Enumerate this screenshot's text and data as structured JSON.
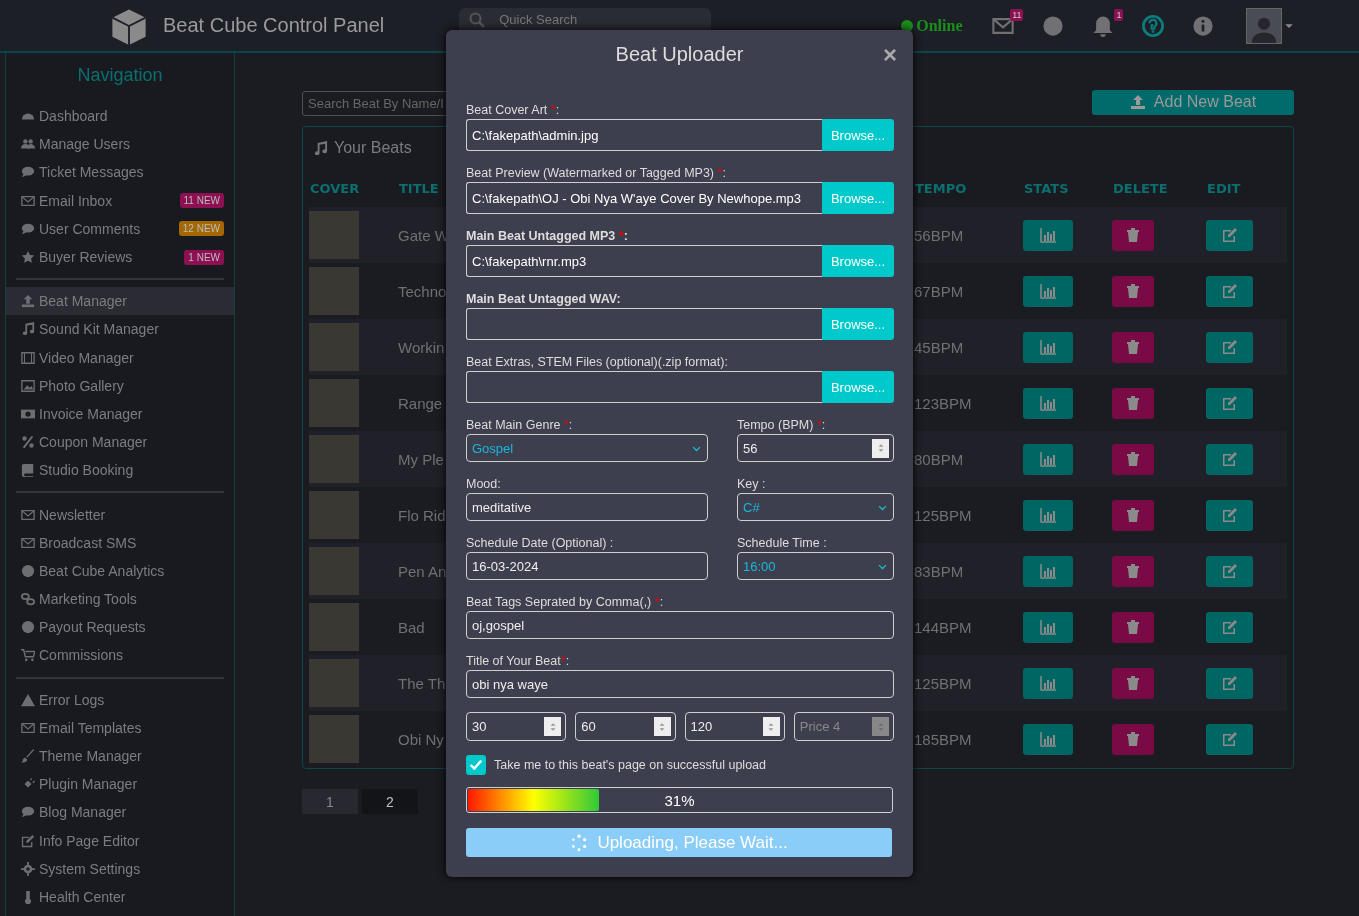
{
  "topbar": {
    "title": "Beat Cube Control Panel",
    "search": {
      "placeholder": "Quick Search"
    },
    "status": "Online",
    "mail_badge": "11",
    "bell_badge": "1"
  },
  "sidebar": {
    "title": "Navigation",
    "sections": [
      {
        "items": [
          {
            "label": "Dashboard",
            "selected": false
          },
          {
            "label": "Manage Users",
            "selected": false
          },
          {
            "label": "Ticket Messages",
            "selected": false
          },
          {
            "label": "Email Inbox",
            "selected": false,
            "badge": {
              "text": "11 NEW",
              "color": "#8c1052"
            }
          },
          {
            "label": "User Comments",
            "selected": false,
            "badge": {
              "text": "12 NEW",
              "color": "#a56800"
            }
          },
          {
            "label": "Buyer Reviews",
            "selected": false,
            "badge": {
              "text": "1 NEW",
              "color": "#8c1052"
            }
          }
        ]
      },
      {
        "items": [
          {
            "label": "Beat Manager",
            "selected": true
          },
          {
            "label": "Sound Kit Manager",
            "selected": false
          },
          {
            "label": "Video Manager",
            "selected": false
          },
          {
            "label": "Photo Gallery",
            "selected": false
          },
          {
            "label": "Invoice Manager",
            "selected": false
          },
          {
            "label": "Coupon Manager",
            "selected": false
          },
          {
            "label": "Studio Booking",
            "selected": false
          }
        ]
      },
      {
        "items": [
          {
            "label": "Newsletter",
            "selected": false
          },
          {
            "label": "Broadcast SMS",
            "selected": false
          },
          {
            "label": "Beat Cube Analytics",
            "selected": false
          },
          {
            "label": "Marketing Tools",
            "selected": false
          },
          {
            "label": "Payout Requests",
            "selected": false
          },
          {
            "label": "Commissions",
            "selected": false
          }
        ]
      },
      {
        "items": [
          {
            "label": "Error Logs",
            "selected": false
          },
          {
            "label": "Email Templates",
            "selected": false
          },
          {
            "label": "Theme Manager",
            "selected": false
          },
          {
            "label": "Plugin Manager",
            "selected": false
          },
          {
            "label": "Blog Manager",
            "selected": false
          },
          {
            "label": "Info Page Editor",
            "selected": false
          },
          {
            "label": "System Settings",
            "selected": false
          },
          {
            "label": "Health Center",
            "selected": false
          }
        ]
      }
    ]
  },
  "main": {
    "search": {
      "placeholder": "Search Beat By Name/I"
    },
    "add_button": "Add New Beat",
    "table": {
      "title": "Your Beats",
      "columns": [
        "COVER",
        "TITLE",
        "TEMPO",
        "STATS",
        "DELETE",
        "EDIT"
      ],
      "rows": [
        {
          "title": "Gate W",
          "tempo": "56BPM"
        },
        {
          "title": "Techno",
          "tempo": "67BPM"
        },
        {
          "title": "Workin",
          "tempo": "45BPM"
        },
        {
          "title": "Range",
          "tempo": "123BPM"
        },
        {
          "title": "My Ple",
          "tempo": "80BPM"
        },
        {
          "title": "Flo Rid",
          "tempo": "125BPM"
        },
        {
          "title": "Pen An",
          "tempo": "83BPM"
        },
        {
          "title": "Bad",
          "tempo": "144BPM"
        },
        {
          "title": "The Th",
          "tempo": "125BPM"
        },
        {
          "title": "Obi Ny",
          "tempo": "185BPM"
        }
      ]
    },
    "pagination": [
      {
        "label": "1",
        "selected": false
      },
      {
        "label": "2",
        "selected": true
      }
    ]
  },
  "modal": {
    "title": "Beat Uploader",
    "close": "×",
    "rows": [
      [
        {
          "kind": "file",
          "label": "Beat Cover Art ",
          "asterisk": "*",
          "tail": ":",
          "bold": false,
          "value": "C:\\fakepath\\admin.jpg",
          "button": "Browse..."
        }
      ],
      [
        {
          "kind": "file",
          "label": "Beat Preview (Watermarked or Tagged MP3) ",
          "asterisk": "*",
          "tail": ":",
          "bold": false,
          "value": "C:\\fakepath\\OJ - Obi Nya W'aye Cover By Newhope.mp3",
          "button": "Browse..."
        }
      ],
      [
        {
          "kind": "file",
          "label": "Main Beat Untagged MP3 ",
          "asterisk": "*",
          "tail": ":",
          "bold": true,
          "value": "C:\\fakepath\\rnr.mp3",
          "button": "Browse..."
        }
      ],
      [
        {
          "kind": "file",
          "label": "Main Beat Untagged WAV:",
          "bold": true,
          "button": "Browse..."
        }
      ],
      [
        {
          "kind": "file",
          "label": "Beat Extras, STEM Files (optional)(.zip format):",
          "bold": false,
          "button": "Browse..."
        }
      ],
      [
        {
          "kind": "select",
          "label": "Beat Main Genre ",
          "asterisk": "*",
          "tail": ":",
          "bold": false,
          "value": "Gospel"
        },
        {
          "kind": "number",
          "label": "Tempo (BPM) ",
          "asterisk": "*",
          "tail": ":",
          "bold": false,
          "value": "56"
        }
      ],
      [
        {
          "kind": "text",
          "label": "Mood:",
          "bold": false,
          "value": "meditative"
        },
        {
          "kind": "select",
          "label": "Key :",
          "bold": false,
          "value": "C#"
        }
      ],
      [
        {
          "kind": "text",
          "label": "Schedule Date (Optional) :",
          "bold": false,
          "value": "16-03-2024"
        },
        {
          "kind": "select",
          "label": "Schedule Time :",
          "bold": false,
          "value": "16:00"
        }
      ],
      [
        {
          "kind": "text",
          "label": "Beat Tags Seprated by Comma(,) ",
          "asterisk": "*",
          "tail": ":",
          "bold": false,
          "value": "oj,gospel"
        }
      ],
      [
        {
          "kind": "text",
          "label": "Title of Your Beat",
          "asterisk": "*",
          "tail": ":",
          "bold": false,
          "value": "obi nya waye"
        }
      ]
    ],
    "prices": [
      {
        "value": "30",
        "disabled": false
      },
      {
        "value": "60",
        "disabled": false
      },
      {
        "value": "120",
        "disabled": false
      },
      {
        "placeholder": "Price 4",
        "disabled": true
      }
    ],
    "redirect": {
      "label": "Take me to this beat's page on successful upload",
      "checked": true
    },
    "progress": {
      "level": 0.31,
      "reading": "31%"
    },
    "submit": "Uploading, Please Wait..."
  }
}
